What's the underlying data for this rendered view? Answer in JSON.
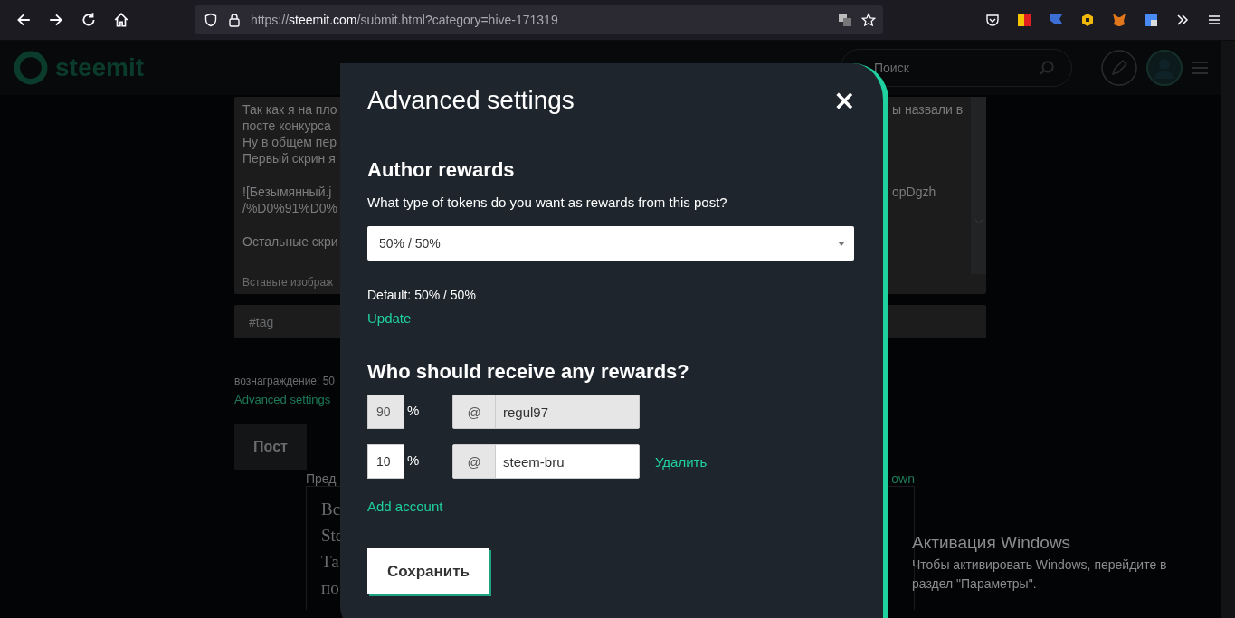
{
  "browser": {
    "url_prefix": "https://",
    "url_domain": "steemit.com",
    "url_path": "/submit.html?category=hive-171319"
  },
  "site_header": {
    "logo": "steemit",
    "search_placeholder": "Поиск"
  },
  "editor": {
    "paragraphs": [
      [
        {
          "left": "Так как я на пло",
          "right": "ы назвали в"
        },
        {
          "left": "посте конкурса"
        },
        {
          "left": "Ну в общем пер"
        },
        {
          "left": "Первый скрин я"
        }
      ],
      [
        {
          "left": "![Безымянный.j",
          "right": "opDgzh"
        },
        {
          "left": "/%D0%91%D0%"
        }
      ],
      [
        {
          "left": "Остальные скри"
        }
      ]
    ],
    "hint": "Вставьте изображ"
  },
  "tags_field": {
    "placeholder": "#tag"
  },
  "rewards_note": "вознаграждение: 50",
  "advanced_link": "Advanced settings",
  "post_button": "Пост",
  "preview_label": "Пред",
  "markdown_link": "own",
  "preview_lines": [
    "Вс",
    "Ste",
    "Та",
    "по"
  ],
  "modal": {
    "title": "Advanced settings",
    "close": "×",
    "author_rewards": {
      "heading": "Author rewards",
      "question": "What type of tokens do you want as rewards from this post?",
      "selected_option": "50% / 50%",
      "default_text": "Default: 50% / 50%",
      "update_link": "Update"
    },
    "beneficiaries": {
      "heading": "Who should receive any rewards?",
      "rows": [
        {
          "percent": "90",
          "percent_sign": "%",
          "at": "@",
          "account": "regul97",
          "disabled": true
        },
        {
          "percent": "10",
          "percent_sign": "%",
          "at": "@",
          "account": "steem-bru",
          "disabled": false,
          "remove_link": "Удалить"
        }
      ],
      "add_link": "Add account"
    },
    "save_button": "Сохранить"
  },
  "os_notice": {
    "title": "Активация Windows",
    "text": "Чтобы активировать Windows, перейдите в раздел \"Параметры\"."
  }
}
